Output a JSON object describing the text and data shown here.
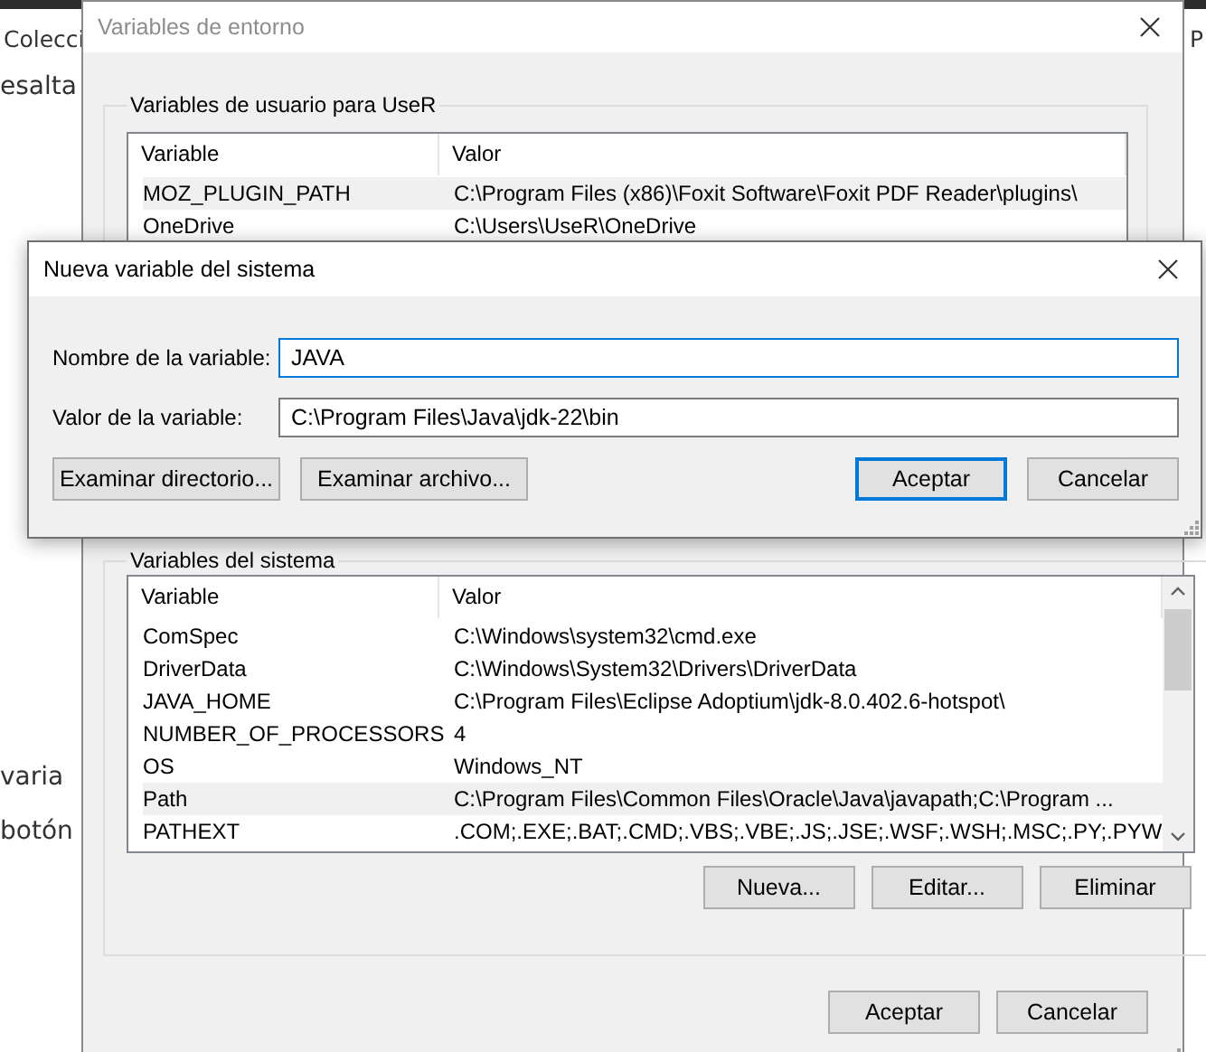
{
  "background_page": {
    "left_texts": [
      "Colecci",
      "esalta",
      "varia",
      "botón"
    ],
    "right_texts": [
      "P"
    ]
  },
  "env_window": {
    "title": "Variables de entorno",
    "user_group": {
      "label": "Variables de usuario para UseR",
      "columns": [
        "Variable",
        "Valor"
      ],
      "rows": [
        {
          "variable": "MOZ_PLUGIN_PATH",
          "value": "C:\\Program Files (x86)\\Foxit Software\\Foxit PDF Reader\\plugins\\",
          "selected": true
        },
        {
          "variable": "OneDrive",
          "value": "C:\\Users\\UseR\\OneDrive",
          "selected": false
        }
      ]
    },
    "system_group": {
      "label": "Variables del sistema",
      "columns": [
        "Variable",
        "Valor"
      ],
      "rows": [
        {
          "variable": "ComSpec",
          "value": "C:\\Windows\\system32\\cmd.exe",
          "selected": false
        },
        {
          "variable": "DriverData",
          "value": "C:\\Windows\\System32\\Drivers\\DriverData",
          "selected": false
        },
        {
          "variable": "JAVA_HOME",
          "value": "C:\\Program Files\\Eclipse Adoptium\\jdk-8.0.402.6-hotspot\\",
          "selected": false
        },
        {
          "variable": "NUMBER_OF_PROCESSORS",
          "value": "4",
          "selected": false
        },
        {
          "variable": "OS",
          "value": "Windows_NT",
          "selected": false
        },
        {
          "variable": "Path",
          "value": "C:\\Program Files\\Common Files\\Oracle\\Java\\javapath;C:\\Program ...",
          "selected": true
        },
        {
          "variable": "PATHEXT",
          "value": ".COM;.EXE;.BAT;.CMD;.VBS;.VBE;.JS;.JSE;.WSF;.WSH;.MSC;.PY;.PYW",
          "selected": false
        }
      ],
      "buttons": [
        "Nueva...",
        "Editar...",
        "Eliminar"
      ]
    },
    "buttons": [
      "Aceptar",
      "Cancelar"
    ]
  },
  "new_var_dialog": {
    "title": "Nueva variable del sistema",
    "fields": [
      {
        "label": "Nombre de la variable:",
        "value": "JAVA",
        "focused": true
      },
      {
        "label": "Valor de la variable:",
        "value": "C:\\Program Files\\Java\\jdk-22\\bin",
        "focused": false
      }
    ],
    "buttons": [
      {
        "label": "Examinar directorio...",
        "default": false
      },
      {
        "label": "Examinar archivo...",
        "default": false
      },
      {
        "label": "Aceptar",
        "default": true
      },
      {
        "label": "Cancelar",
        "default": false
      }
    ]
  }
}
